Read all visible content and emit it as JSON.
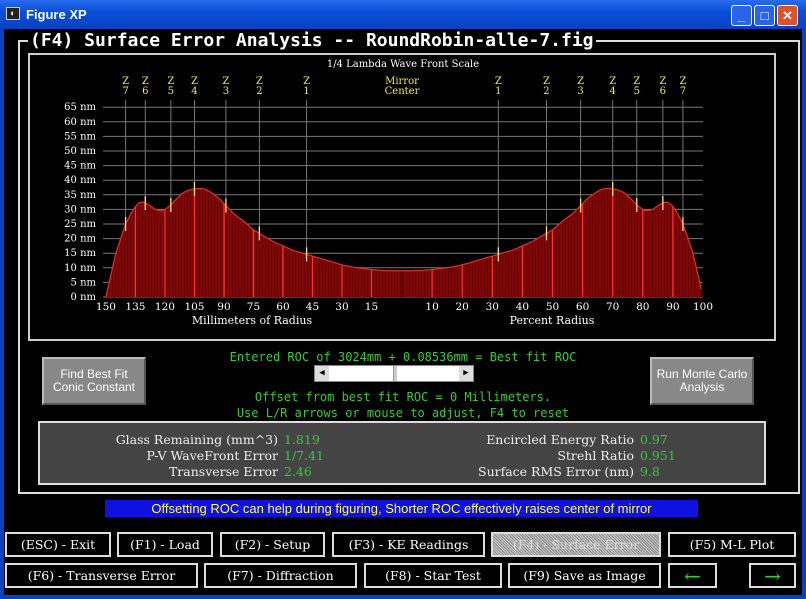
{
  "window": {
    "title": "Figure XP",
    "controls": [
      "minimize",
      "maximize",
      "close"
    ]
  },
  "heading": "(F4) Surface Error Analysis -- RoundRobin-alle-7.fig",
  "chart_data": {
    "type": "area",
    "title": "1/4 Lambda Wave Front Scale",
    "xlabel_left": "Millimeters of Radius",
    "xlabel_right": "Percent Radius",
    "y_ticks": [
      "0 nm",
      "5 nm",
      "10 nm",
      "15 nm",
      "20 nm",
      "25 nm",
      "30 nm",
      "35 nm",
      "40 nm",
      "45 nm",
      "50 nm",
      "55 nm",
      "60 nm",
      "65 nm"
    ],
    "ylim": [
      0,
      65
    ],
    "x_ticks_left_mm": [
      "150",
      "135",
      "120",
      "105",
      "90",
      "75",
      "60",
      "45",
      "30",
      "15"
    ],
    "x_ticks_right_percent": [
      "10",
      "20",
      "30",
      "40",
      "50",
      "60",
      "70",
      "80",
      "90",
      "100"
    ],
    "center_label": [
      "Mirror",
      "Center"
    ],
    "zones": [
      {
        "label": [
          "Z",
          "7"
        ],
        "mm": 140
      },
      {
        "label": [
          "Z",
          "6"
        ],
        "mm": 130
      },
      {
        "label": [
          "Z",
          "5"
        ],
        "mm": 117
      },
      {
        "label": [
          "Z",
          "4"
        ],
        "mm": 105
      },
      {
        "label": [
          "Z",
          "3"
        ],
        "mm": 89
      },
      {
        "label": [
          "Z",
          "2"
        ],
        "mm": 72
      },
      {
        "label": [
          "Z",
          "1"
        ],
        "mm": 48
      }
    ],
    "series": [
      {
        "x_mm": [
          150,
          147,
          145,
          142,
          140,
          137,
          135,
          133,
          131,
          128,
          125,
          122,
          120,
          117,
          115,
          112,
          110,
          107,
          105,
          102,
          100,
          97,
          95,
          92,
          90,
          85,
          80,
          75,
          70,
          65,
          60,
          55,
          50,
          45,
          40,
          35,
          30,
          25,
          20,
          15,
          10,
          5,
          0
        ],
        "y_nm": [
          0,
          9,
          15,
          21,
          25,
          29,
          31,
          32.3,
          32.5,
          31.5,
          30,
          29.5,
          30,
          31.5,
          33,
          35,
          36,
          36.8,
          37,
          37.2,
          37,
          36,
          35,
          33.5,
          32,
          28.5,
          26,
          23,
          21,
          19,
          17.5,
          16,
          15,
          14,
          13,
          12,
          11,
          10.3,
          9.8,
          9.4,
          9.1,
          9,
          9
        ]
      }
    ],
    "grid": true,
    "colors": {
      "curve": "#e03030",
      "fill": "#6a0000",
      "grid": "#777",
      "zone_label": "#ee4",
      "axis_text": "#fff",
      "zone_marker": "#ffe080"
    }
  },
  "roc": {
    "entered": "Entered ROC of 3024mm + 0.08536mm = Best fit ROC",
    "offset": "Offset from best fit ROC = 0 Millimeters.",
    "hint": "Use L/R arrows or mouse to adjust, F4 to reset",
    "slider_value": 0.5
  },
  "buttons": {
    "conic": "Find Best Fit Conic Constant",
    "monte": "Run Monte Carlo Analysis"
  },
  "stats": {
    "glass_label": "Glass Remaining (mm^3)",
    "glass": "1.819",
    "pv_label": "P-V WaveFront Error",
    "pv": "1/7.41",
    "trans_label": "Transverse Error",
    "trans": "2.46",
    "ee_label": "Encircled Energy Ratio",
    "ee": "0.97",
    "strehl_label": "Strehl Ratio",
    "strehl": "0.951",
    "rms_label": "Surface RMS Error (nm)",
    "rms": "9.8"
  },
  "banner": "Offsetting ROC can help during figuring, Shorter ROC effectively raises center of mirror",
  "nav": {
    "esc": "(ESC) - Exit",
    "f1": "(F1) - Load",
    "f2": "(F2) - Setup",
    "f3": "(F3) - KE Readings",
    "f4": "(F4) - Surface Error",
    "f5": "(F5) M-L Plot",
    "f6": "(F6) - Transverse Error",
    "f7": "(F7) - Diffraction",
    "f8": "(F8) - Star Test",
    "f9": "(F9) Save as Image",
    "prev": "←",
    "next": "→"
  }
}
